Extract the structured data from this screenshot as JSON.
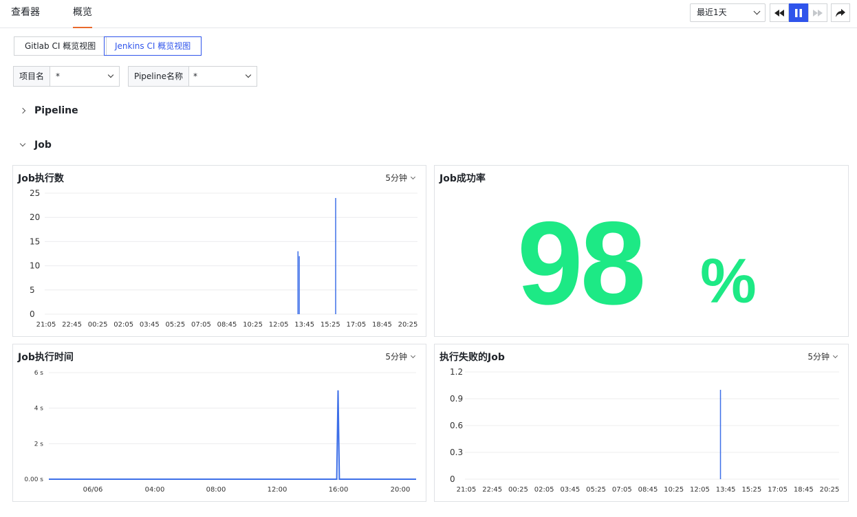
{
  "tabs": [
    {
      "label": "查看器",
      "active": false
    },
    {
      "label": "概览",
      "active": true
    }
  ],
  "toolbar": {
    "time_range": "最近1天",
    "controls": [
      "rewind-icon",
      "pause-icon",
      "fast-forward-icon",
      "share-icon"
    ]
  },
  "views": [
    {
      "label": "Gitlab CI 概览视图",
      "active": false
    },
    {
      "label": "Jenkins CI 概览视图",
      "active": true
    }
  ],
  "filters": [
    {
      "label": "项目名",
      "value": "*"
    },
    {
      "label": "Pipeline名称",
      "value": "*"
    }
  ],
  "sections": [
    {
      "label": "Pipeline",
      "expanded": false
    },
    {
      "label": "Job",
      "expanded": true
    }
  ],
  "colors": {
    "accent": "#2f54eb",
    "tab_underline": "#e8692c",
    "series": "#3d6fe8",
    "success": "#1de985"
  },
  "panels": {
    "job_count": {
      "title": "Job执行数",
      "interval": "5分钟"
    },
    "success_rate": {
      "title": "Job成功率",
      "value": "98",
      "unit": "%"
    },
    "job_duration": {
      "title": "Job执行时间",
      "interval": "5分钟"
    },
    "failed_jobs": {
      "title": "执行失败的Job",
      "interval": "5分钟"
    }
  },
  "chart_data": [
    {
      "id": "job_count",
      "type": "bar",
      "title": "Job执行数",
      "x_ticks": [
        "21:05",
        "22:45",
        "00:25",
        "02:05",
        "03:45",
        "05:25",
        "07:05",
        "08:45",
        "10:25",
        "12:05",
        "13:45",
        "15:25",
        "17:05",
        "18:45",
        "20:25"
      ],
      "y_ticks": [
        "0",
        "5",
        "10",
        "15",
        "20",
        "25"
      ],
      "ylim": [
        0,
        25
      ],
      "spikes": [
        {
          "x": "13:20",
          "y": 13
        },
        {
          "x": "13:25",
          "y": 12
        },
        {
          "x": "15:45",
          "y": 24
        }
      ],
      "grid": true
    },
    {
      "id": "job_duration",
      "type": "line",
      "title": "Job执行时间",
      "x_ticks": [
        "06/06",
        "04:00",
        "08:00",
        "12:00",
        "16:00",
        "20:00"
      ],
      "y_ticks": [
        "0.00 s",
        "2 s",
        "4 s",
        "6 s"
      ],
      "ylim": [
        0,
        6
      ],
      "series": [
        {
          "points": [
            [
              "21:05",
              0
            ],
            [
              "15:50",
              0
            ],
            [
              "15:55",
              5
            ],
            [
              "16:00",
              0
            ],
            [
              "21:00",
              0
            ]
          ]
        }
      ],
      "grid": true
    },
    {
      "id": "failed_jobs",
      "type": "bar",
      "title": "执行失败的Job",
      "x_ticks": [
        "21:05",
        "22:45",
        "00:25",
        "02:05",
        "03:45",
        "05:25",
        "07:05",
        "08:45",
        "10:25",
        "12:05",
        "13:45",
        "15:25",
        "17:05",
        "18:45",
        "20:25"
      ],
      "y_ticks": [
        "0",
        "0.3",
        "0.6",
        "0.9",
        "1.2"
      ],
      "ylim": [
        0,
        1.2
      ],
      "spikes": [
        {
          "x": "13:25",
          "y": 1
        }
      ],
      "grid": true
    }
  ]
}
